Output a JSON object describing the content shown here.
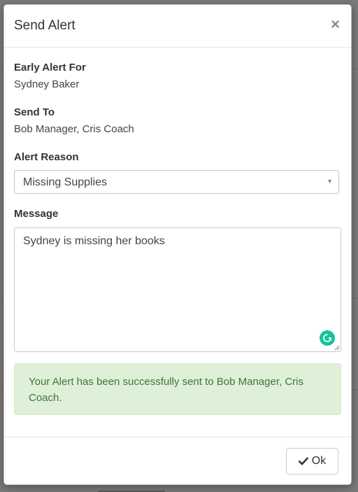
{
  "dialog": {
    "title": "Send Alert",
    "close_label": "×"
  },
  "fields": {
    "early_alert_label": "Early Alert For",
    "early_alert_value": "Sydney Baker",
    "send_to_label": "Send To",
    "send_to_value": "Bob Manager, Cris Coach",
    "reason_label": "Alert Reason",
    "reason_value": "Missing Supplies",
    "message_label": "Message",
    "message_value": "Sydney is missing her books"
  },
  "status": {
    "success_message": "Your Alert has been successfully sent to Bob Manager, Cris Coach."
  },
  "footer": {
    "ok_label": "Ok",
    "ok_icon": "check-icon"
  },
  "colors": {
    "success_bg": "#dff0d8",
    "success_text": "#3c763d",
    "grammar_icon": "#15c39a"
  }
}
